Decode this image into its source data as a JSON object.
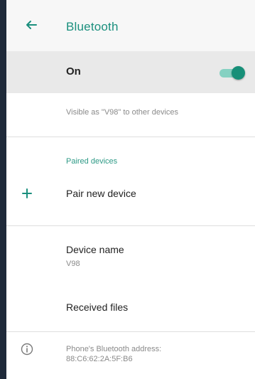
{
  "appbar": {
    "title": "Bluetooth",
    "back_icon": "arrow-left-icon"
  },
  "colors": {
    "accent": "#1a8f7d",
    "switch_thumb": "#178f78",
    "switch_track": "#86d1c2"
  },
  "bluetooth_toggle": {
    "label": "On",
    "state": "on"
  },
  "visibility_text": "Visible as \"V98\" to other devices",
  "paired_section": {
    "header": "Paired devices"
  },
  "pair_new": {
    "label": "Pair new device",
    "icon": "plus-icon"
  },
  "device_name": {
    "label": "Device name",
    "value": "V98"
  },
  "received_files": {
    "label": "Received files"
  },
  "address": {
    "label": "Phone's Bluetooth address:",
    "value": "88:C6:62:2A:5F:B6",
    "icon": "info-icon"
  }
}
